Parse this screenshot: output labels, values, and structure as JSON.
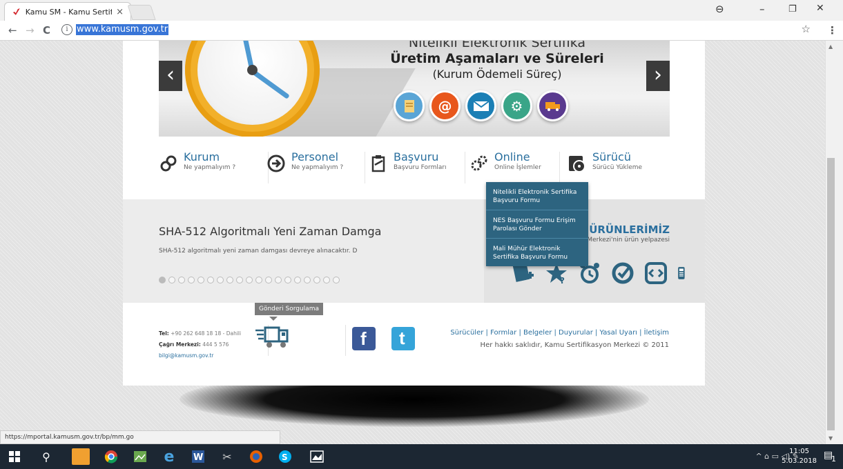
{
  "browser": {
    "tab_title": "Kamu SM - Kamu Sertifik",
    "tab_close": "×",
    "url": "www.kamusm.gov.tr",
    "status_url": "https://mportal.kamusm.gov.tr/bp/mm.go",
    "back": "←",
    "forward": "→",
    "reload": "C",
    "info": "i",
    "star": "☆",
    "menu": "⋮",
    "minimize": "–",
    "restore": "❐",
    "close": "✕",
    "account": "⊖"
  },
  "slider": {
    "title_line1": "Nitelikli Elektronik Sertifika",
    "title_line2": "Üretim Aşamaları ve Süreleri",
    "title_line3": "(Kurum Ödemeli Süreç)",
    "prev": "‹",
    "next": "›",
    "steps": [
      {
        "icon": "document-icon",
        "color": "#5aa5d6"
      },
      {
        "icon": "at-icon",
        "color": "#e8571c"
      },
      {
        "icon": "mail-icon",
        "color": "#1b7fb5"
      },
      {
        "icon": "gears-icon",
        "color": "#3aa588"
      },
      {
        "icon": "truck-icon",
        "color": "#5a3a8f"
      }
    ]
  },
  "nav": {
    "items": [
      {
        "title": "Kurum",
        "subtitle": "Ne yapmalıyım ?"
      },
      {
        "title": "Personel",
        "subtitle": "Ne yapmalıyım ?"
      },
      {
        "title": "Başvuru",
        "subtitle": "Başvuru Formları"
      },
      {
        "title": "Online",
        "subtitle": "Online İşlemler"
      },
      {
        "title": "Sürücü",
        "subtitle": "Sürücü Yükleme"
      }
    ]
  },
  "dropdown": {
    "items": [
      "Nitelikli Elektronik Sertifika Başvuru Formu",
      "NES Başvuru Formu Erişim Parolası Gönder",
      "Mali Mühür Elektronik Sertifika Başvuru Formu"
    ]
  },
  "news": {
    "title": "SHA-512 Algoritmalı Yeni Zaman Damga",
    "text": "SHA-512 algoritmalı yeni zaman damgası devreye alınacaktır. D",
    "dot_count": 19,
    "active_dot": 0
  },
  "products": {
    "title": "ÜRÜNLERİMİZ",
    "subtitle": "Kamu Sertifikasyon Merkezi'nin ürün yelpazesi",
    "icons": [
      "certificate-add-icon",
      "star-help-icon",
      "alarm-clock-icon",
      "check-circle-icon",
      "code-refresh-icon",
      "smart-card-reader-icon"
    ]
  },
  "footer": {
    "tel_label": "Tel:",
    "tel_value": "+90 262 648 18 18 - Dahili",
    "call_label": "Çağrı Merkezi:",
    "call_value": "444 5 576",
    "email": "bilgi@kamusm.gov.tr",
    "tooltip": "Gönderi Sorgulama",
    "links": "Sürücüler | Formlar | Belgeler | Duyurular | Yasal Uyarı | İletişim",
    "copyright": "Her hakkı saklıdır, Kamu Sertifikasyon Merkezi © 2011",
    "facebook": "f",
    "twitter": "t"
  },
  "taskbar": {
    "time": "11:05",
    "date": "5.03.2018",
    "tray": "^ ⌂ ▭ ◁) ✎",
    "notif_count": "1"
  }
}
